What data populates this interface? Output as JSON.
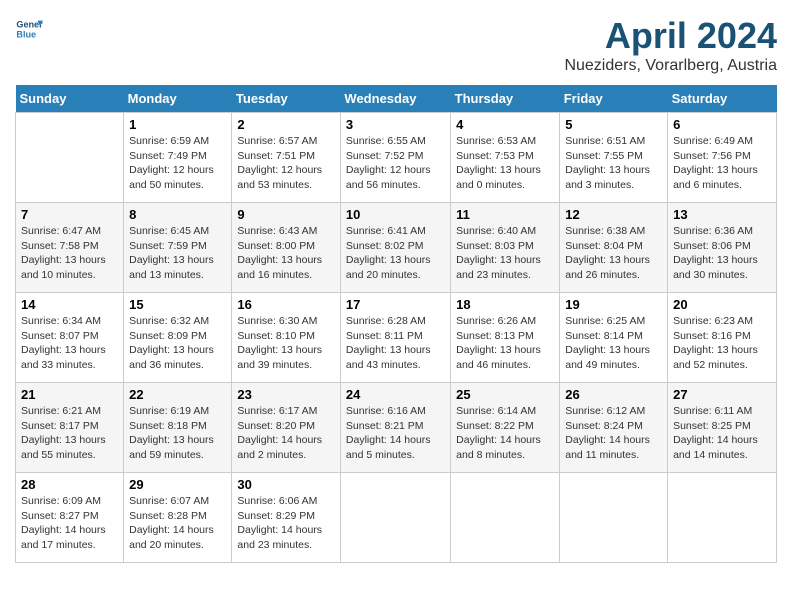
{
  "logo": {
    "line1": "General",
    "line2": "Blue"
  },
  "title": "April 2024",
  "location": "Nueziders, Vorarlberg, Austria",
  "weekdays": [
    "Sunday",
    "Monday",
    "Tuesday",
    "Wednesday",
    "Thursday",
    "Friday",
    "Saturday"
  ],
  "weeks": [
    [
      {
        "day": "",
        "info": ""
      },
      {
        "day": "1",
        "info": "Sunrise: 6:59 AM\nSunset: 7:49 PM\nDaylight: 12 hours\nand 50 minutes."
      },
      {
        "day": "2",
        "info": "Sunrise: 6:57 AM\nSunset: 7:51 PM\nDaylight: 12 hours\nand 53 minutes."
      },
      {
        "day": "3",
        "info": "Sunrise: 6:55 AM\nSunset: 7:52 PM\nDaylight: 12 hours\nand 56 minutes."
      },
      {
        "day": "4",
        "info": "Sunrise: 6:53 AM\nSunset: 7:53 PM\nDaylight: 13 hours\nand 0 minutes."
      },
      {
        "day": "5",
        "info": "Sunrise: 6:51 AM\nSunset: 7:55 PM\nDaylight: 13 hours\nand 3 minutes."
      },
      {
        "day": "6",
        "info": "Sunrise: 6:49 AM\nSunset: 7:56 PM\nDaylight: 13 hours\nand 6 minutes."
      }
    ],
    [
      {
        "day": "7",
        "info": "Sunrise: 6:47 AM\nSunset: 7:58 PM\nDaylight: 13 hours\nand 10 minutes."
      },
      {
        "day": "8",
        "info": "Sunrise: 6:45 AM\nSunset: 7:59 PM\nDaylight: 13 hours\nand 13 minutes."
      },
      {
        "day": "9",
        "info": "Sunrise: 6:43 AM\nSunset: 8:00 PM\nDaylight: 13 hours\nand 16 minutes."
      },
      {
        "day": "10",
        "info": "Sunrise: 6:41 AM\nSunset: 8:02 PM\nDaylight: 13 hours\nand 20 minutes."
      },
      {
        "day": "11",
        "info": "Sunrise: 6:40 AM\nSunset: 8:03 PM\nDaylight: 13 hours\nand 23 minutes."
      },
      {
        "day": "12",
        "info": "Sunrise: 6:38 AM\nSunset: 8:04 PM\nDaylight: 13 hours\nand 26 minutes."
      },
      {
        "day": "13",
        "info": "Sunrise: 6:36 AM\nSunset: 8:06 PM\nDaylight: 13 hours\nand 30 minutes."
      }
    ],
    [
      {
        "day": "14",
        "info": "Sunrise: 6:34 AM\nSunset: 8:07 PM\nDaylight: 13 hours\nand 33 minutes."
      },
      {
        "day": "15",
        "info": "Sunrise: 6:32 AM\nSunset: 8:09 PM\nDaylight: 13 hours\nand 36 minutes."
      },
      {
        "day": "16",
        "info": "Sunrise: 6:30 AM\nSunset: 8:10 PM\nDaylight: 13 hours\nand 39 minutes."
      },
      {
        "day": "17",
        "info": "Sunrise: 6:28 AM\nSunset: 8:11 PM\nDaylight: 13 hours\nand 43 minutes."
      },
      {
        "day": "18",
        "info": "Sunrise: 6:26 AM\nSunset: 8:13 PM\nDaylight: 13 hours\nand 46 minutes."
      },
      {
        "day": "19",
        "info": "Sunrise: 6:25 AM\nSunset: 8:14 PM\nDaylight: 13 hours\nand 49 minutes."
      },
      {
        "day": "20",
        "info": "Sunrise: 6:23 AM\nSunset: 8:16 PM\nDaylight: 13 hours\nand 52 minutes."
      }
    ],
    [
      {
        "day": "21",
        "info": "Sunrise: 6:21 AM\nSunset: 8:17 PM\nDaylight: 13 hours\nand 55 minutes."
      },
      {
        "day": "22",
        "info": "Sunrise: 6:19 AM\nSunset: 8:18 PM\nDaylight: 13 hours\nand 59 minutes."
      },
      {
        "day": "23",
        "info": "Sunrise: 6:17 AM\nSunset: 8:20 PM\nDaylight: 14 hours\nand 2 minutes."
      },
      {
        "day": "24",
        "info": "Sunrise: 6:16 AM\nSunset: 8:21 PM\nDaylight: 14 hours\nand 5 minutes."
      },
      {
        "day": "25",
        "info": "Sunrise: 6:14 AM\nSunset: 8:22 PM\nDaylight: 14 hours\nand 8 minutes."
      },
      {
        "day": "26",
        "info": "Sunrise: 6:12 AM\nSunset: 8:24 PM\nDaylight: 14 hours\nand 11 minutes."
      },
      {
        "day": "27",
        "info": "Sunrise: 6:11 AM\nSunset: 8:25 PM\nDaylight: 14 hours\nand 14 minutes."
      }
    ],
    [
      {
        "day": "28",
        "info": "Sunrise: 6:09 AM\nSunset: 8:27 PM\nDaylight: 14 hours\nand 17 minutes."
      },
      {
        "day": "29",
        "info": "Sunrise: 6:07 AM\nSunset: 8:28 PM\nDaylight: 14 hours\nand 20 minutes."
      },
      {
        "day": "30",
        "info": "Sunrise: 6:06 AM\nSunset: 8:29 PM\nDaylight: 14 hours\nand 23 minutes."
      },
      {
        "day": "",
        "info": ""
      },
      {
        "day": "",
        "info": ""
      },
      {
        "day": "",
        "info": ""
      },
      {
        "day": "",
        "info": ""
      }
    ]
  ]
}
